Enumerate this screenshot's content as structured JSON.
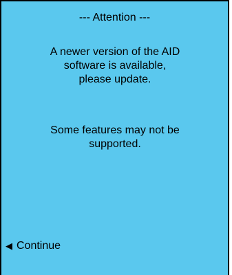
{
  "dialog": {
    "title": "--- Attention ---",
    "message_primary": "A newer version of the AID software is available, please update.",
    "message_secondary": "Some features may not be supported.",
    "continue_label": "Continue",
    "continue_icon": "left-arrow-icon",
    "background_color": "#5ac8ee"
  }
}
